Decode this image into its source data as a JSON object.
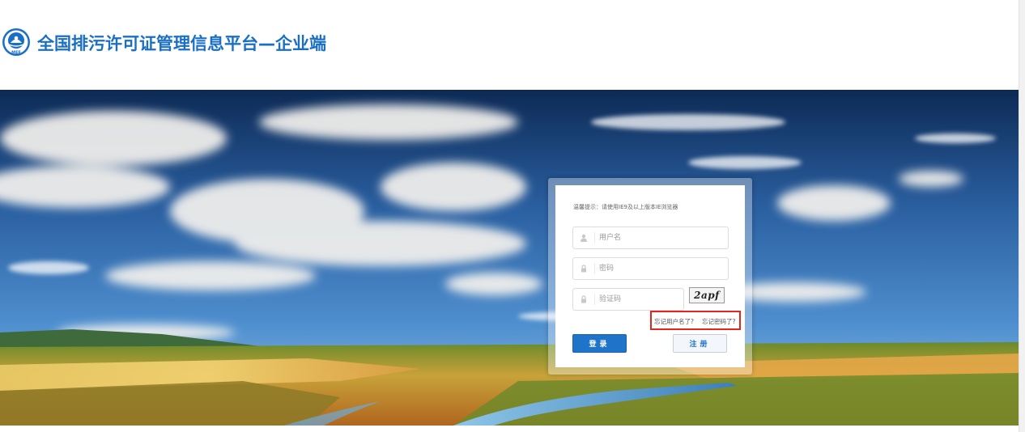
{
  "header": {
    "title": "全国排污许可证管理信息平台—企业端",
    "logo_icon": "ministry-emblem-icon",
    "logo_text": "MEE"
  },
  "login": {
    "tip": "温馨提示：请使用IE9及以上版本IE浏览器",
    "username": {
      "placeholder": "用户名",
      "value": "",
      "icon": "user-icon"
    },
    "password": {
      "placeholder": "密码",
      "value": "",
      "icon": "lock-icon"
    },
    "captcha_input": {
      "placeholder": "验证码",
      "value": "",
      "icon": "lock-icon"
    },
    "captcha_text": "2apf",
    "forgot_username": "忘记用户名了?",
    "forgot_password": "忘记密码了?",
    "login_button": "登录",
    "register_button": "注册"
  },
  "colors": {
    "brand_blue": "#1a6fc4",
    "button_blue": "#1f74c9",
    "highlight_red": "#e0281e"
  }
}
